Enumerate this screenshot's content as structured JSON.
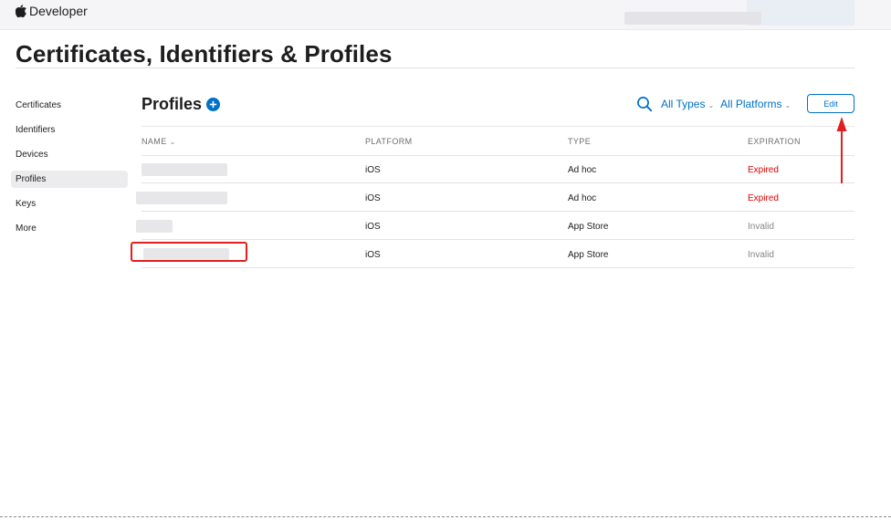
{
  "header": {
    "brand": "Developer",
    "icon": "apple-logo-icon"
  },
  "page": {
    "title": "Certificates, Identifiers & Profiles"
  },
  "sidebar": {
    "items": [
      {
        "label": "Certificates",
        "active": false
      },
      {
        "label": "Identifiers",
        "active": false
      },
      {
        "label": "Devices",
        "active": false
      },
      {
        "label": "Profiles",
        "active": true
      },
      {
        "label": "Keys",
        "active": false
      },
      {
        "label": "More",
        "active": false
      }
    ]
  },
  "section": {
    "title": "Profiles",
    "add_icon": "plus-circle-icon"
  },
  "filters": {
    "search_icon": "search-icon",
    "types": "All Types",
    "platforms": "All Platforms"
  },
  "actions": {
    "edit_label": "Edit"
  },
  "table": {
    "columns": {
      "name": "NAME",
      "platform": "PLATFORM",
      "type": "TYPE",
      "expiration": "EXPIRATION"
    },
    "rows": [
      {
        "name": "",
        "platform": "iOS",
        "type": "Ad hoc",
        "expiration": "Expired",
        "status": "expired"
      },
      {
        "name": "",
        "platform": "iOS",
        "type": "Ad hoc",
        "expiration": "Expired",
        "status": "expired"
      },
      {
        "name": "",
        "platform": "iOS",
        "type": "App Store",
        "expiration": "Invalid",
        "status": "invalid"
      },
      {
        "name": "",
        "platform": "iOS",
        "type": "App Store",
        "expiration": "Invalid",
        "status": "invalid",
        "highlighted": true
      }
    ]
  },
  "colors": {
    "accent": "#0070c9",
    "expired": "#e30000",
    "invalid": "#86868b",
    "annotation": "#e0201e"
  }
}
